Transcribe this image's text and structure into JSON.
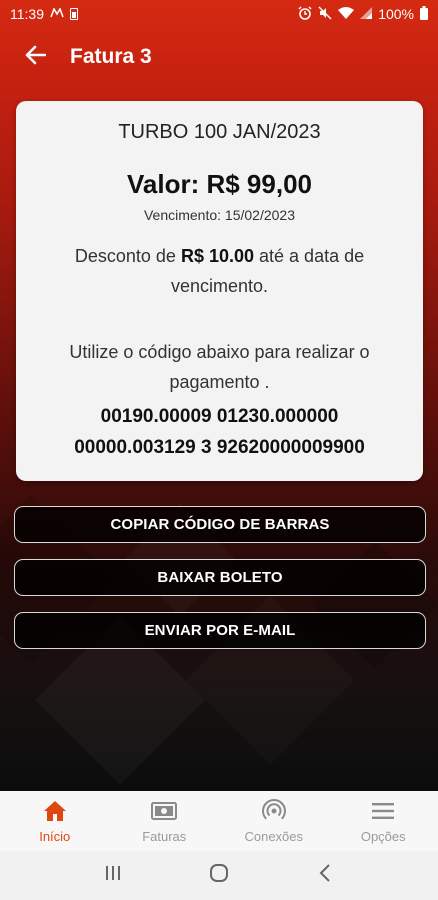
{
  "status_bar": {
    "time": "11:39",
    "battery": "100%"
  },
  "app_bar": {
    "title": "Fatura 3"
  },
  "invoice": {
    "plan_name": "TURBO 100 JAN/2023",
    "valor": "Valor: R$ 99,00",
    "vencimento": "Vencimento: 15/02/2023",
    "desconto_prefix": "Desconto de ",
    "desconto_amount": "R$ 10.00",
    "desconto_suffix": " até a data de vencimento.",
    "utilize_text": "Utilize o código abaixo para realizar o pagamento .",
    "barcode_line1": "00190.00009 01230.000000",
    "barcode_line2": "00000.003129 3 92620000009900"
  },
  "actions": {
    "copy_barcode": "COPIAR CÓDIGO DE BARRAS",
    "download_boleto": "BAIXAR BOLETO",
    "send_email": "ENVIAR POR E-MAIL"
  },
  "bottom_nav": {
    "items": [
      {
        "label": "Início",
        "icon": "home-icon",
        "active": true
      },
      {
        "label": "Faturas",
        "icon": "invoice-icon",
        "active": false
      },
      {
        "label": "Conexões",
        "icon": "wifi-signal-icon",
        "active": false
      },
      {
        "label": "Opções",
        "icon": "menu-icon",
        "active": false
      }
    ]
  },
  "colors": {
    "accent": "#e0460f",
    "header_red": "#d42a12",
    "card_bg": "#f3f3f3",
    "inactive_nav": "#9a9a9a"
  }
}
